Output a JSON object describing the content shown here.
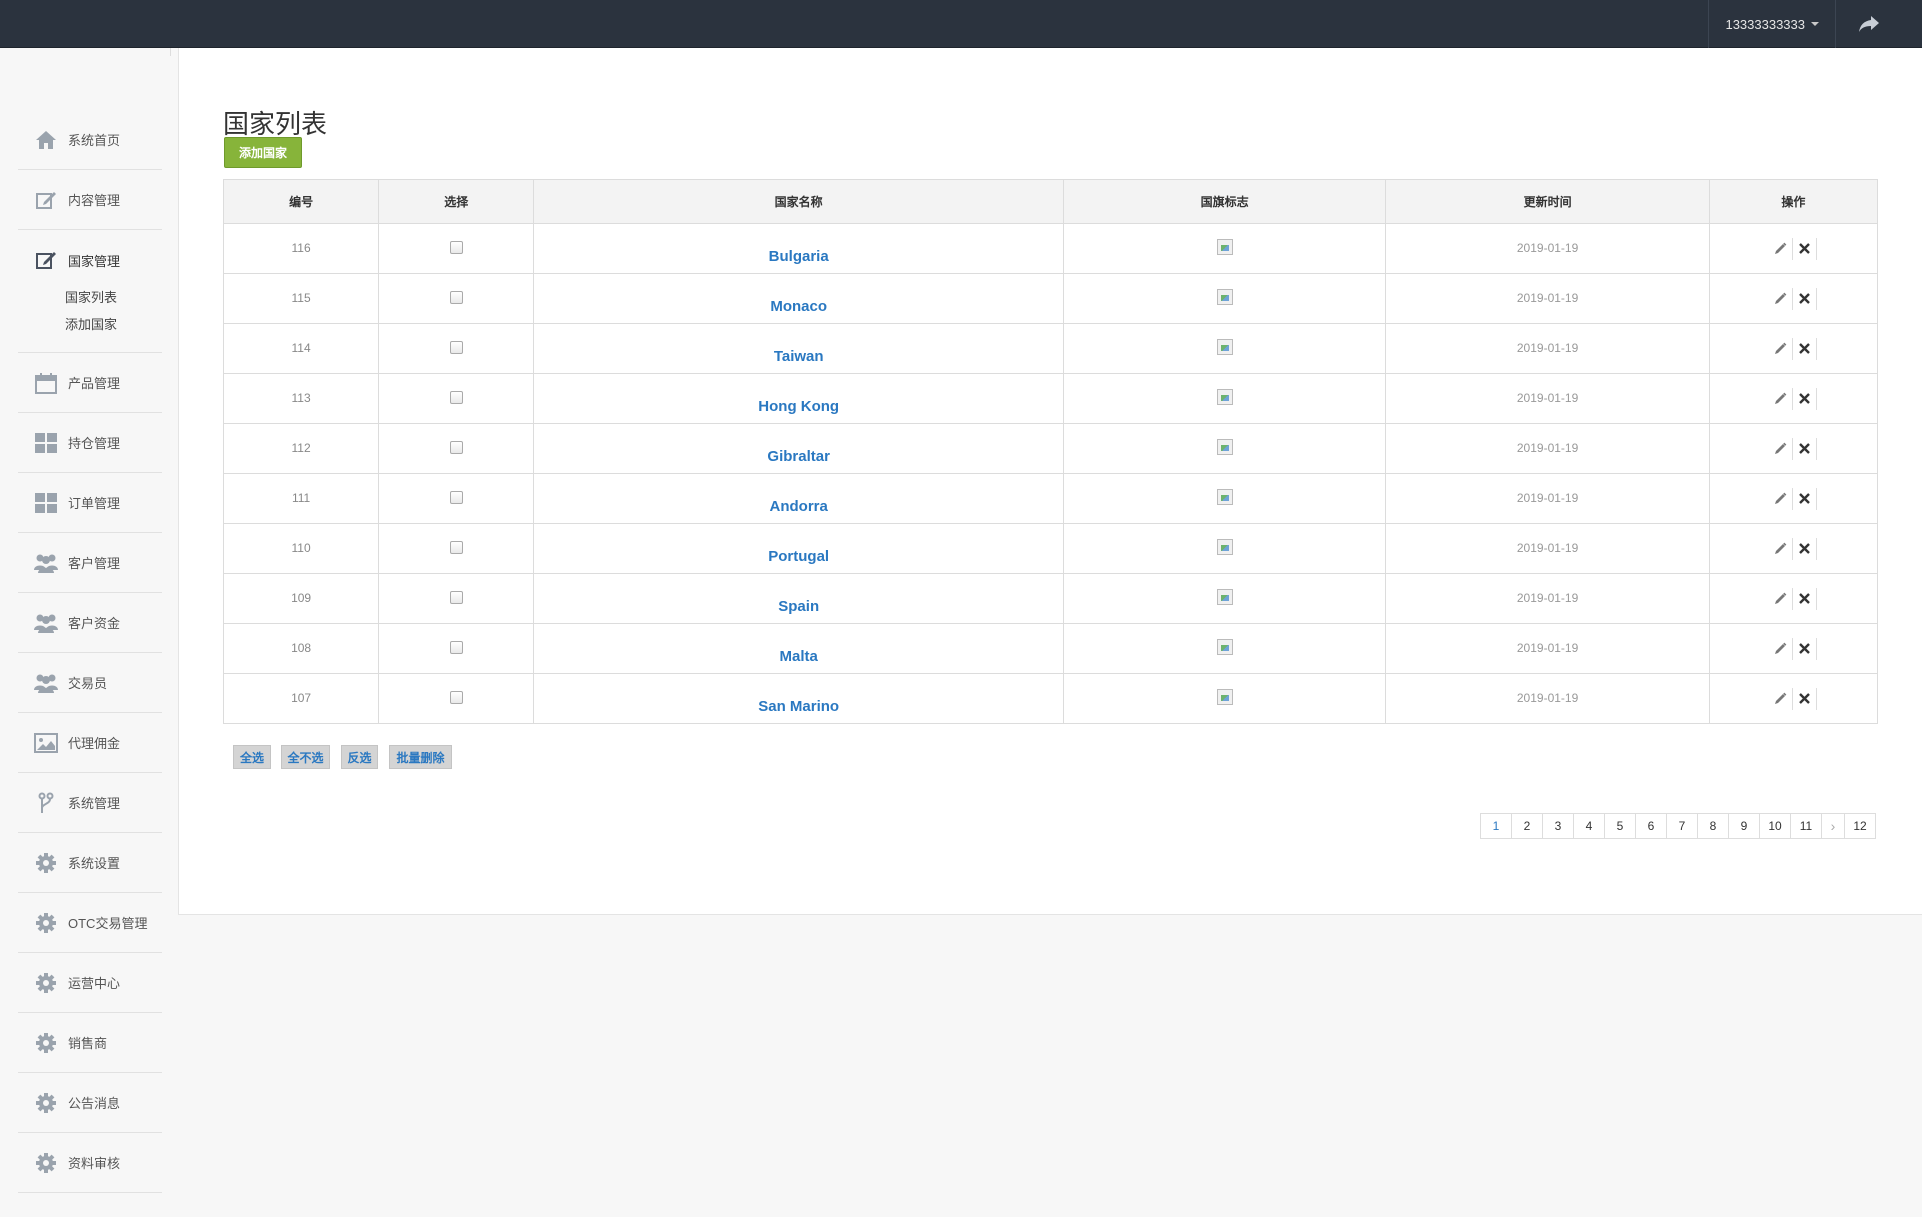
{
  "header": {
    "username": "13333333333"
  },
  "sidebar": {
    "items": [
      {
        "label": "系统首页",
        "icon": "home-icon"
      },
      {
        "label": "内容管理",
        "icon": "edit-icon"
      },
      {
        "label": "国家管理",
        "icon": "edit-icon",
        "active": true,
        "children": [
          {
            "label": "国家列表"
          },
          {
            "label": "添加国家"
          }
        ]
      },
      {
        "label": "产品管理",
        "icon": "calendar-icon"
      },
      {
        "label": "持仓管理",
        "icon": "dashboard-icon"
      },
      {
        "label": "订单管理",
        "icon": "dashboard-icon"
      },
      {
        "label": "客户管理",
        "icon": "group-icon"
      },
      {
        "label": "客户资金",
        "icon": "group-icon"
      },
      {
        "label": "交易员",
        "icon": "group-icon"
      },
      {
        "label": "代理佣金",
        "icon": "picture-icon"
      },
      {
        "label": "系统管理",
        "icon": "branch-icon"
      },
      {
        "label": "系统设置",
        "icon": "gear-icon"
      },
      {
        "label": "OTC交易管理",
        "icon": "gear-icon"
      },
      {
        "label": "运营中心",
        "icon": "gear-icon"
      },
      {
        "label": "销售商",
        "icon": "gear-icon"
      },
      {
        "label": "公告消息",
        "icon": "gear-icon"
      },
      {
        "label": "资料审核",
        "icon": "gear-icon"
      }
    ]
  },
  "main": {
    "title": "国家列表",
    "add_button": "添加国家",
    "columns": [
      "编号",
      "选择",
      "国家名称",
      "国旗标志",
      "更新时间",
      "操作"
    ],
    "rows": [
      {
        "id": "116",
        "name": "Bulgaria",
        "updated": "2019-01-19"
      },
      {
        "id": "115",
        "name": "Monaco",
        "updated": "2019-01-19"
      },
      {
        "id": "114",
        "name": "Taiwan",
        "updated": "2019-01-19"
      },
      {
        "id": "113",
        "name": "Hong Kong",
        "updated": "2019-01-19"
      },
      {
        "id": "112",
        "name": "Gibraltar",
        "updated": "2019-01-19"
      },
      {
        "id": "111",
        "name": "Andorra",
        "updated": "2019-01-19"
      },
      {
        "id": "110",
        "name": "Portugal",
        "updated": "2019-01-19"
      },
      {
        "id": "109",
        "name": "Spain",
        "updated": "2019-01-19"
      },
      {
        "id": "108",
        "name": "Malta",
        "updated": "2019-01-19"
      },
      {
        "id": "107",
        "name": "San Marino",
        "updated": "2019-01-19"
      }
    ],
    "bulk_actions": [
      "全选",
      "全不选",
      "反选",
      "批量删除"
    ],
    "pagination": {
      "pages": [
        "1",
        "2",
        "3",
        "4",
        "5",
        "6",
        "7",
        "8",
        "9",
        "10",
        "11"
      ],
      "next": "›",
      "last": "12",
      "current": "1"
    }
  },
  "colors": {
    "topbar": "#2b333e",
    "add_button": "#87b43a",
    "link": "#2a78c1"
  }
}
